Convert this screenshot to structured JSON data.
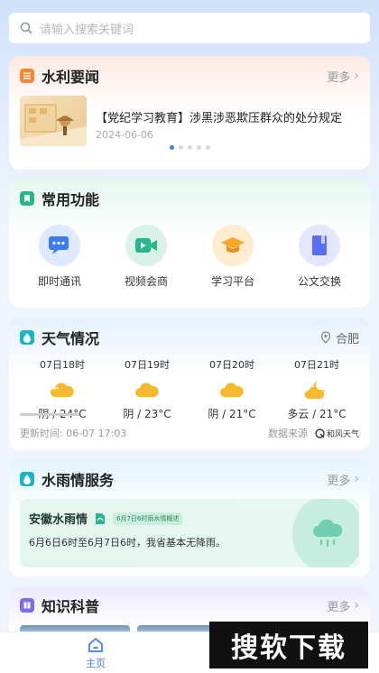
{
  "search": {
    "placeholder": "请输入搜索关键词"
  },
  "news": {
    "title": "水利要闻",
    "more": "更多",
    "items": [
      {
        "title": "【党纪学习教育】涉黑涉恶欺压群众的处分规定",
        "date": "2024-06-06"
      }
    ],
    "page_count": 5,
    "active_page": 1
  },
  "functions": {
    "title": "常用功能",
    "items": [
      {
        "label": "即时通讯",
        "icon": "chat-icon",
        "color": "#3b7cf6"
      },
      {
        "label": "视频会商",
        "icon": "video-icon",
        "color": "#2bb58c"
      },
      {
        "label": "学习平台",
        "icon": "graduation-cap-icon",
        "color": "#f5a623"
      },
      {
        "label": "公文交换",
        "icon": "document-icon",
        "color": "#5b6ef0"
      }
    ]
  },
  "weather": {
    "title": "天气情况",
    "location": "合肥",
    "items": [
      {
        "time": "07日18时",
        "desc": "阴 / 24°C",
        "icon": "cloudy-icon"
      },
      {
        "time": "07日19时",
        "desc": "阴 / 23°C",
        "icon": "cloudy-icon"
      },
      {
        "time": "07日20时",
        "desc": "阴 / 21°C",
        "icon": "cloudy-icon"
      },
      {
        "time": "07日21时",
        "desc": "多云 / 21°C",
        "icon": "partly-cloudy-night-icon"
      }
    ],
    "updated": "更新时间:  06-07 17:03",
    "source_label": "数据来源",
    "source_brand": "和风天气"
  },
  "rain": {
    "title": "水雨情服务",
    "more": "更多",
    "subtitle": "安徽水雨情",
    "tag": "6月7日6时雨水情概述",
    "text": "6月6日6时至6月7日6时，我省基本无降雨。"
  },
  "knowledge": {
    "title": "知识科普",
    "more": "更多"
  },
  "tabbar": {
    "home": "主页"
  },
  "watermark": "搜软下载"
}
